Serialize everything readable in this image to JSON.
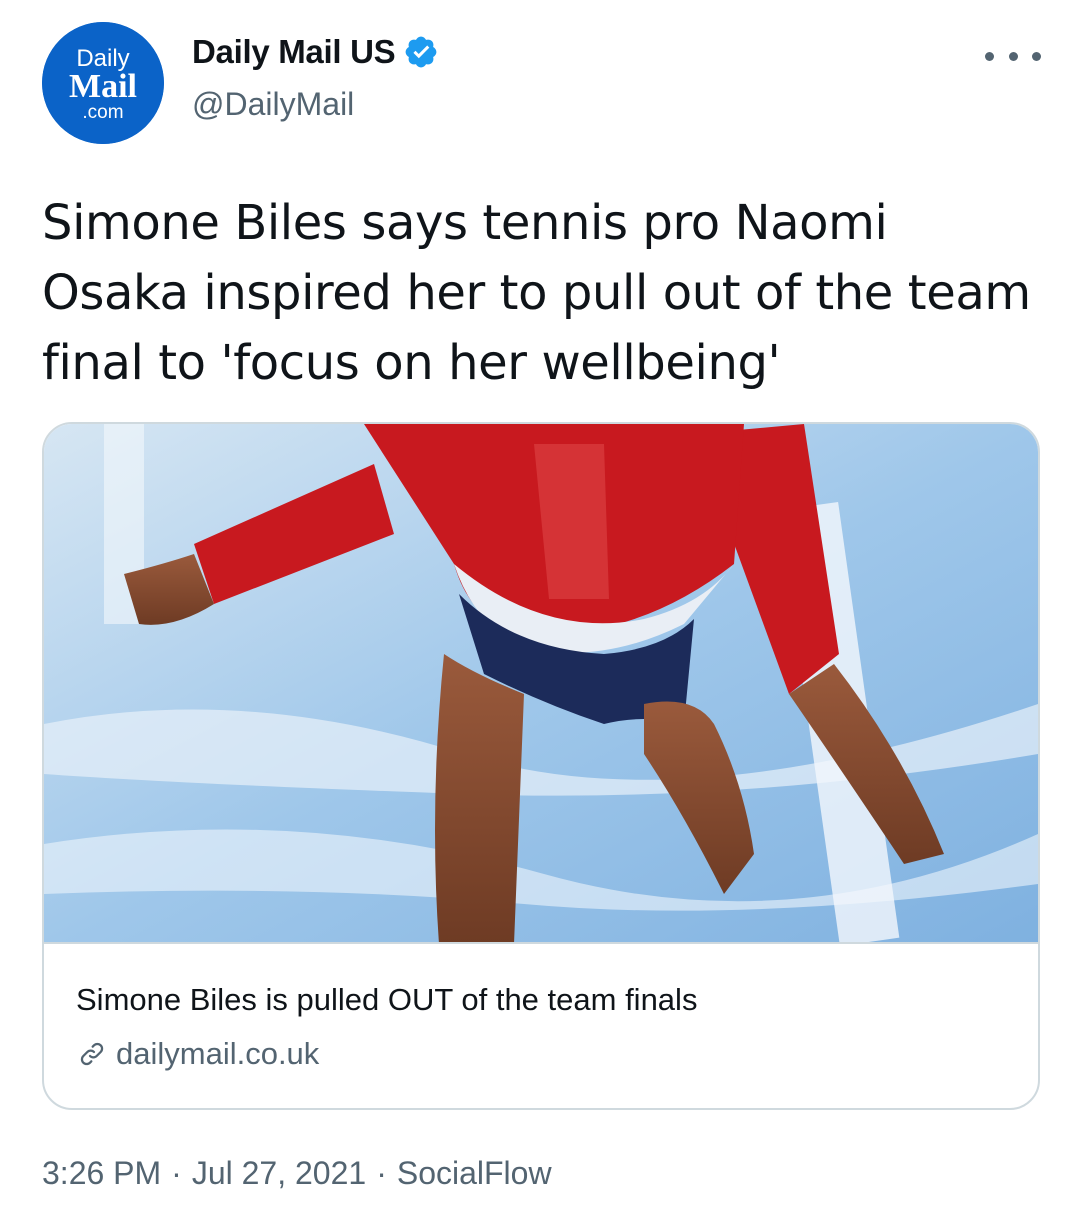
{
  "author": {
    "display_name": "Daily Mail US",
    "handle": "@DailyMail",
    "verified": true,
    "avatar_logo": {
      "line1": "Daily",
      "line2": "Mail",
      "line3": ".com",
      "color": "#0b63c8"
    }
  },
  "menu_icon": "more-horizontal-icon",
  "tweet": {
    "text": "Simone Biles says tennis pro Naomi Osaka inspired her to pull out of the team final to 'focus on her wellbeing'"
  },
  "card": {
    "title": "Simone Biles is pulled OUT of the team finals",
    "domain": "dailymail.co.uk",
    "domain_icon": "link-icon"
  },
  "footer": {
    "time": "3:26 PM",
    "separator": "·",
    "date": "Jul 27, 2021",
    "source": "SocialFlow"
  },
  "colors": {
    "text_primary": "#0f1419",
    "text_secondary": "#536471",
    "verified": "#1d9bf0",
    "border": "#cfd9de"
  }
}
